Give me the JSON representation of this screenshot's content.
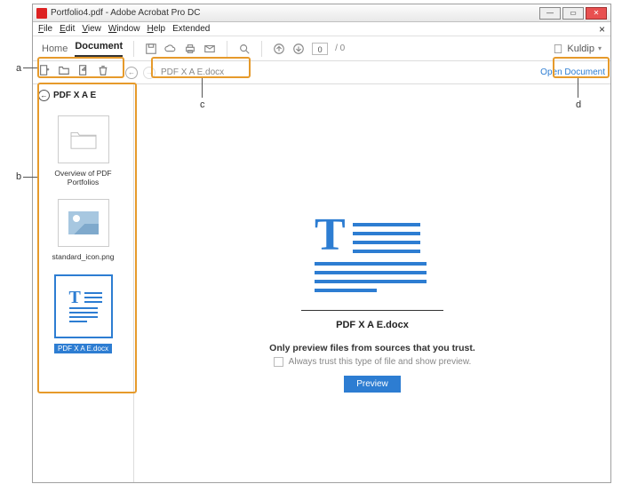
{
  "titlebar": {
    "title": "Portfolio4.pdf - Adobe Acrobat Pro DC"
  },
  "menubar": {
    "file": "File",
    "edit": "Edit",
    "view": "View",
    "window": "Window",
    "help": "Help",
    "extended": "Extended"
  },
  "toolbar": {
    "home": "Home",
    "document": "Document",
    "page_current": "0",
    "page_total": "/ 0",
    "account_name": "Kuldip"
  },
  "secondary": {
    "crumb_file": "PDF X A E.docx",
    "open_document": "Open Document"
  },
  "sidebar": {
    "header": "PDF X A E",
    "items": [
      {
        "label": "Overview of PDF Portfolios"
      },
      {
        "label": "standard_icon.png"
      },
      {
        "label": "PDF X A E.docx"
      }
    ]
  },
  "main": {
    "filename": "PDF X A E.docx",
    "trust_msg": "Only preview files from sources that you trust.",
    "always_msg": "Always trust this type of file and show preview.",
    "preview_btn": "Preview"
  },
  "callouts": {
    "a": "a",
    "b": "b",
    "c": "c",
    "d": "d"
  }
}
